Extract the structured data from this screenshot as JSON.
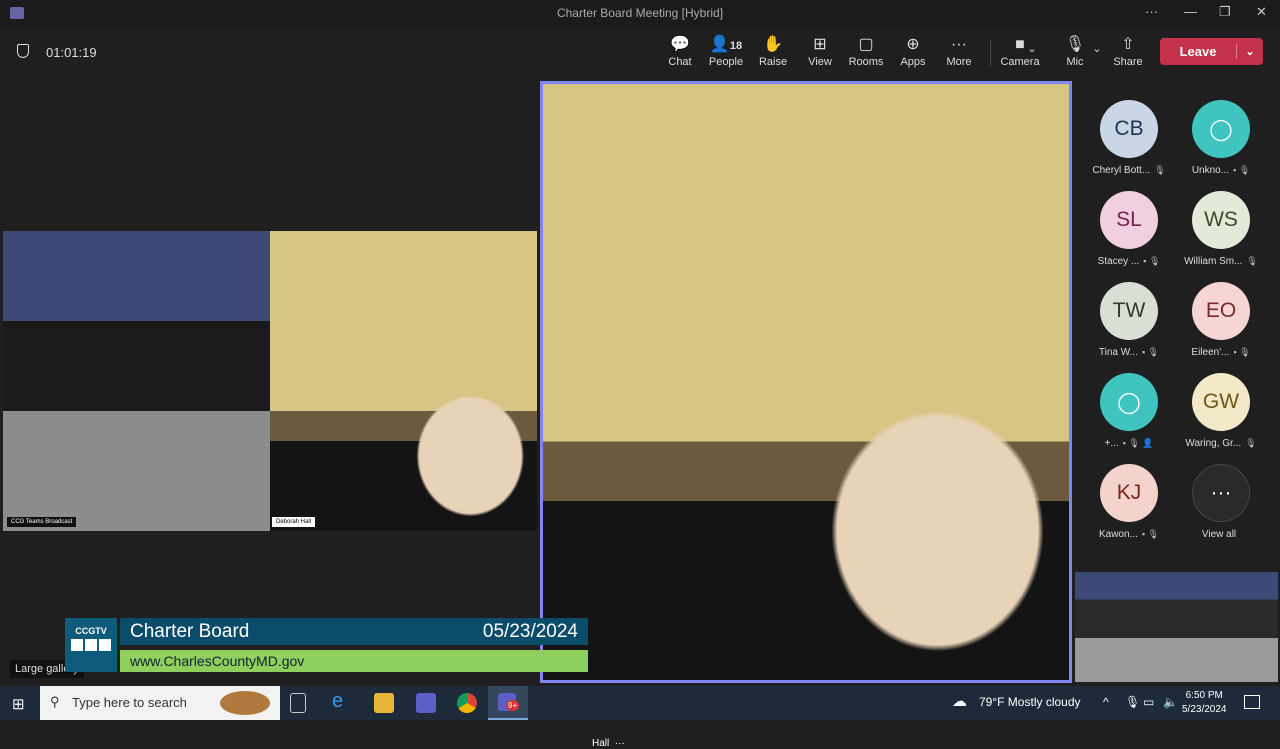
{
  "window": {
    "title": "Charter Board Meeting [Hybrid]",
    "more": "···",
    "minimize": "—",
    "maximize": "❐",
    "close": "✕"
  },
  "toolbar": {
    "timer": "01:01:19",
    "people_count": "18",
    "buttons": [
      {
        "label": "Chat",
        "icon": "💬"
      },
      {
        "label": "People",
        "icon": "👤"
      },
      {
        "label": "Raise",
        "icon": "✋"
      },
      {
        "label": "View",
        "icon": "⊞"
      },
      {
        "label": "Rooms",
        "icon": "▢"
      },
      {
        "label": "Apps",
        "icon": "⊕"
      },
      {
        "label": "More",
        "icon": "···"
      }
    ],
    "camera": "Camera",
    "mic": "Mic",
    "share": "Share",
    "leave": "Leave",
    "chevron": "⌄"
  },
  "stage": {
    "tile1_name": "CCG Teams Broadcast",
    "tile2_name": "Deborah Hall",
    "speaker_name": "Hall",
    "speaker_more": "···",
    "gallery_label": "Large gallery"
  },
  "banner": {
    "logo": "CCGTV",
    "title": "Charter Board",
    "date": "05/23/2024",
    "url": "www.CharlesCountyMD.gov"
  },
  "participants": [
    {
      "initials": "CB",
      "name": "Cheryl Bott...",
      "bg": "#c9d6e6",
      "fg": "#1f3455",
      "status": "🎙"
    },
    {
      "initials": "",
      "name": "Unkno...",
      "bg": "#3fc4bf",
      "fg": "#fff",
      "status": "▪ 🎙",
      "icon": "person"
    },
    {
      "initials": "SL",
      "name": "Stacey ...",
      "bg": "#f0cfe0",
      "fg": "#7a1f4b",
      "status": "▪ 🎙"
    },
    {
      "initials": "WS",
      "name": "William Sm...",
      "bg": "#e4ead8",
      "fg": "#3d4a2b",
      "status": "🎙"
    },
    {
      "initials": "TW",
      "name": "Tina W...",
      "bg": "#d8e0d5",
      "fg": "#2f3a2e",
      "status": "▪ 🎙"
    },
    {
      "initials": "EO",
      "name": "Eileen'...",
      "bg": "#f5d6d2",
      "fg": "#7a2b2b",
      "status": "▪ 🎙"
    },
    {
      "initials": "",
      "name": "+...",
      "bg": "#3fc4bf",
      "fg": "#fff",
      "status": "▪ 🎙 👤",
      "icon": "person"
    },
    {
      "initials": "GW",
      "name": "Waring, Gr...",
      "bg": "#f3e9c8",
      "fg": "#6b5716",
      "status": "🎙"
    },
    {
      "initials": "KJ",
      "name": "Kawon...",
      "bg": "#f3d3cb",
      "fg": "#7a2718",
      "status": "▪ 🎙"
    },
    {
      "initials": "···",
      "name": "View all",
      "bg": "#2a2a2a",
      "fg": "#fff",
      "status": ""
    }
  ],
  "taskbar": {
    "search_placeholder": "Type here to search",
    "weather": "79°F  Mostly cloudy",
    "time": "6:50 PM",
    "date": "5/23/2024",
    "teams_badge": "9+"
  }
}
